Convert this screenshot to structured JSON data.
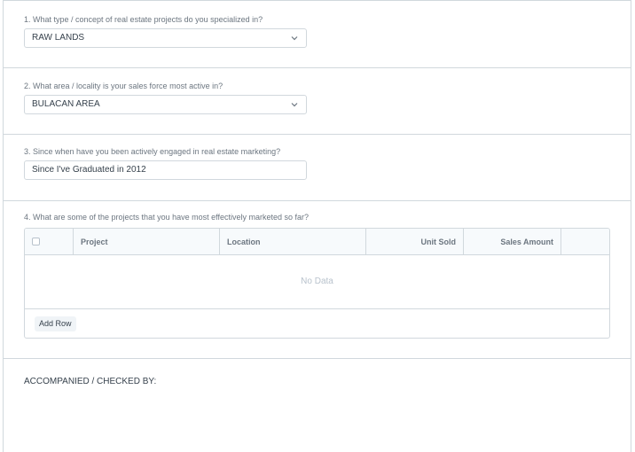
{
  "questions": {
    "q1": {
      "label": "1. What type / concept of real estate projects do you specialized in?",
      "value": "RAW LANDS"
    },
    "q2": {
      "label": "2. What area / locality is your sales force most active in?",
      "value": "BULACAN AREA"
    },
    "q3": {
      "label": "3. Since when have you been actively engaged in real estate marketing?",
      "value": "Since I've Graduated in 2012"
    },
    "q4": {
      "label": "4. What are some of the projects that you have most effectively marketed so far?"
    }
  },
  "projects_table": {
    "columns": [
      "Project",
      "Location",
      "Unit Sold",
      "Sales Amount"
    ],
    "rows": [],
    "empty_text": "No Data",
    "add_row_label": "Add Row"
  },
  "accompanied": {
    "label": "ACCOMPANIED / CHECKED BY:"
  },
  "icons": {
    "select_arrow": "chevron-down-icon",
    "select_all": "checkbox-icon"
  },
  "colors": {
    "border": "#d1d8dd",
    "label": "#6c7680",
    "text": "#36414c",
    "placeholder": "#b8c2cc"
  }
}
